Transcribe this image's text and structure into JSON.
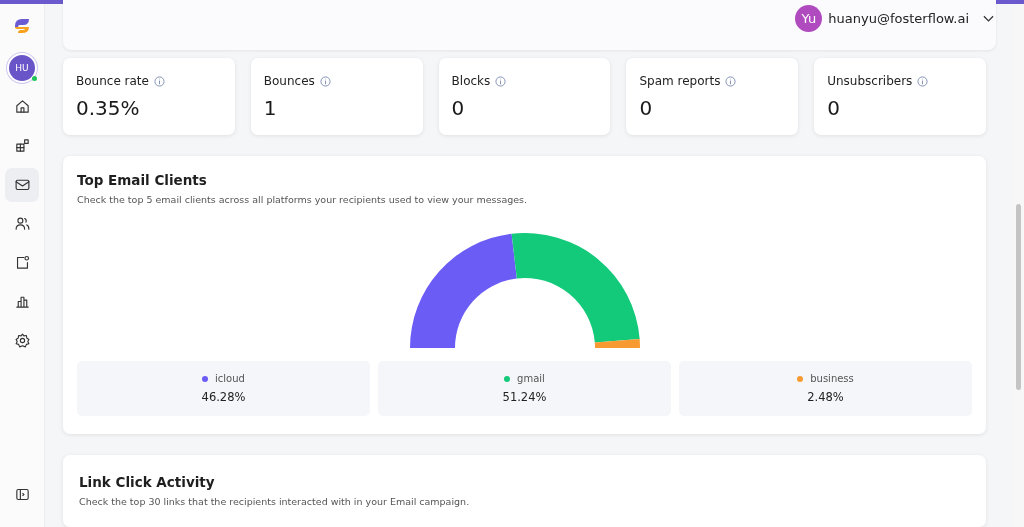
{
  "header": {
    "user": {
      "initials": "Yu",
      "email": "huanyu@fosterflow.ai"
    }
  },
  "sidebar": {
    "avatar": {
      "initials": "HU",
      "online": true
    },
    "items": [
      {
        "kind": "home",
        "selected": false
      },
      {
        "kind": "apps",
        "selected": false
      },
      {
        "kind": "mail",
        "selected": true
      },
      {
        "kind": "users",
        "selected": false
      },
      {
        "kind": "contact",
        "selected": false
      },
      {
        "kind": "chart",
        "selected": false
      },
      {
        "kind": "settings",
        "selected": false
      }
    ]
  },
  "metrics": [
    {
      "label": "Bounce rate",
      "value": "0.35%"
    },
    {
      "label": "Bounces",
      "value": "1"
    },
    {
      "label": "Blocks",
      "value": "0"
    },
    {
      "label": "Spam reports",
      "value": "0"
    },
    {
      "label": "Unsubscribers",
      "value": "0"
    }
  ],
  "email_clients": {
    "title": "Top Email Clients",
    "subtitle": "Check the top 5 email clients across all platforms your recipients used to view your messages.",
    "chart_data": {
      "type": "donut",
      "categories": [
        "icloud",
        "gmail",
        "business"
      ],
      "values": [
        46.28,
        51.24,
        2.48
      ]
    },
    "legend": [
      {
        "value": "46.28%",
        "color": "#6c5cf6"
      },
      {
        "value": "51.24%",
        "color": "#13c97a"
      },
      {
        "value": "2.48%",
        "color": "#f79a32"
      }
    ]
  },
  "link_activity": {
    "title": "Link Click Activity",
    "subtitle": "Check the top 30 links that the recipients interacted with in your Email campaign."
  }
}
